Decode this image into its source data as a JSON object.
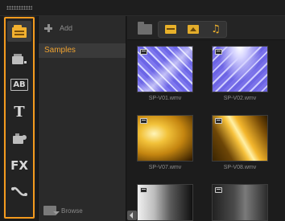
{
  "rail": {
    "items": [
      {
        "name": "media",
        "icon": "media-library-icon"
      },
      {
        "name": "instant-project",
        "icon": "instant-project-icon"
      },
      {
        "name": "transition",
        "icon": "transition-icon",
        "text": "AB"
      },
      {
        "name": "title",
        "icon": "title-icon",
        "text": "T"
      },
      {
        "name": "graphic",
        "icon": "graphic-icon"
      },
      {
        "name": "filter",
        "icon": "fx-filter-icon",
        "text": "FX"
      },
      {
        "name": "path",
        "icon": "motion-path-icon"
      }
    ],
    "active_index": 0,
    "accent": "#f39a1e"
  },
  "library": {
    "add_label": "Add",
    "selected_folder": "Samples",
    "browse_label": "Browse"
  },
  "toolbar": {
    "icons": [
      "folder-icon",
      "show-video-icon",
      "show-photo-icon",
      "show-audio-icon"
    ]
  },
  "media": {
    "items": [
      {
        "caption": "SP-V01.wmv"
      },
      {
        "caption": "SP-V02.wmv"
      },
      {
        "caption": "SP-V07.wmv"
      },
      {
        "caption": "SP-V08.wmv"
      },
      {
        "caption": ""
      },
      {
        "caption": ""
      }
    ]
  },
  "colors": {
    "accent": "#f39a1e",
    "selected_text": "#f0a330",
    "background": "#1b1b1b"
  }
}
